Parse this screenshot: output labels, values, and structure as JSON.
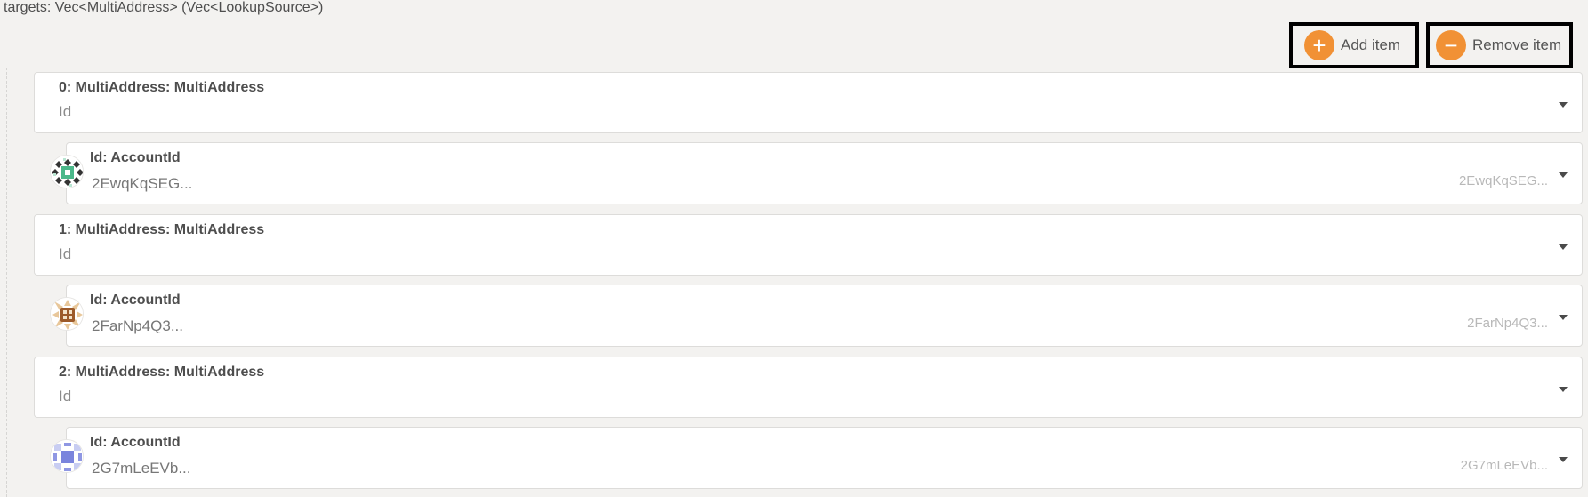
{
  "param": {
    "label": "targets: Vec<MultiAddress> (Vec<LookupSource>)"
  },
  "buttons": {
    "add_label": "Add item",
    "add_icon": "plus-icon",
    "remove_label": "Remove item",
    "remove_icon": "minus-icon"
  },
  "colors": {
    "accent": "#f19135"
  },
  "items": [
    {
      "title": "0: MultiAddress: MultiAddress",
      "variant": "Id",
      "account": {
        "title": "Id: AccountId",
        "value": "2EwqKqSEG...",
        "right_value": "2EwqKqSEG..."
      }
    },
    {
      "title": "1: MultiAddress: MultiAddress",
      "variant": "Id",
      "account": {
        "title": "Id: AccountId",
        "value": "2FarNp4Q3...",
        "right_value": "2FarNp4Q3..."
      }
    },
    {
      "title": "2: MultiAddress: MultiAddress",
      "variant": "Id",
      "account": {
        "title": "Id: AccountId",
        "value": "2G7mLeEVb...",
        "right_value": "2G7mLeEVb..."
      }
    }
  ]
}
